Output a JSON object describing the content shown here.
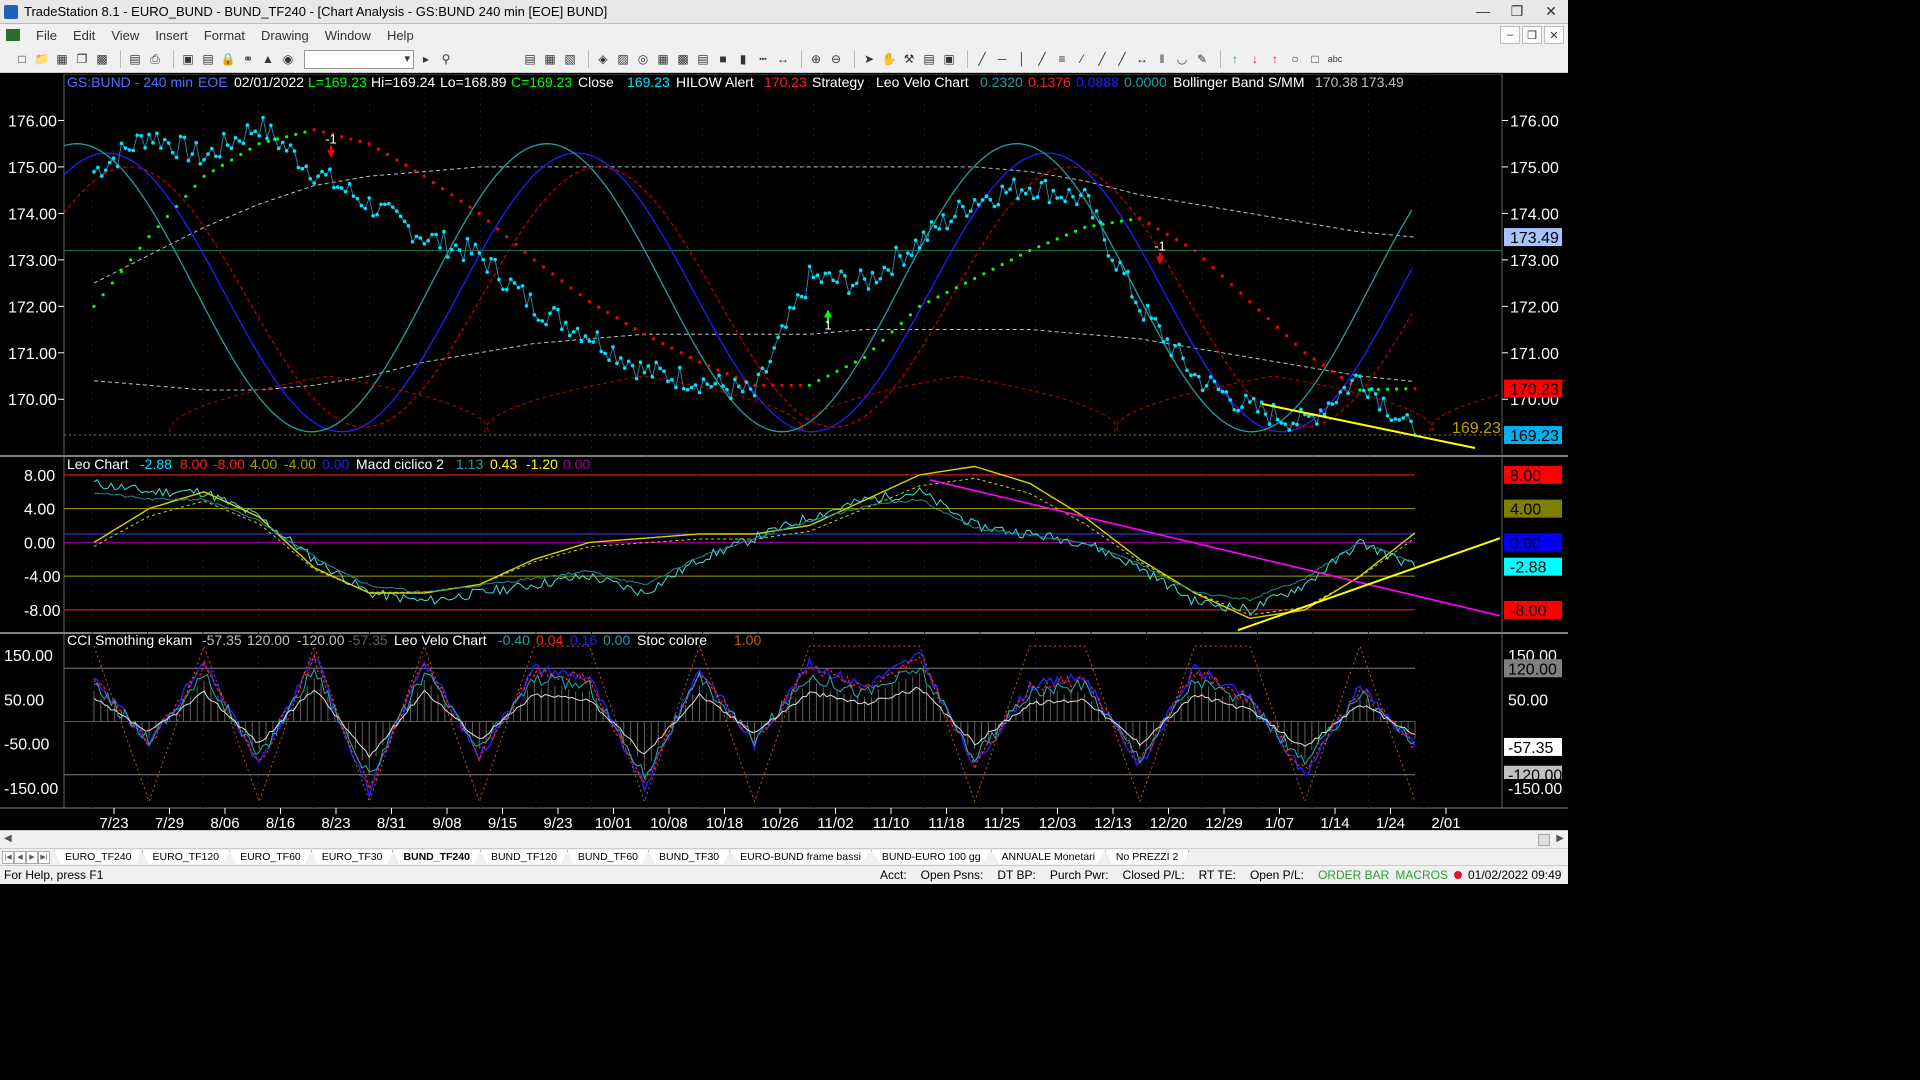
{
  "window": {
    "title": "TradeStation 8.1 - EURO_BUND - BUND_TF240 - [Chart Analysis - GS:BUND  240 min  [EOE] BUND]"
  },
  "menu": [
    "File",
    "Edit",
    "View",
    "Insert",
    "Format",
    "Drawing",
    "Window",
    "Help"
  ],
  "legend": {
    "symbol": "GS:BUND - 240 min",
    "exch": "EOE",
    "date": "02/01/2022",
    "low_label": "L=169.23",
    "high_label": "Hi=169.24",
    "lo_label": "Lo=168.89",
    "close_label": "C=169.23",
    "close_title": "Close",
    "close_value": "169.23",
    "hilow_title": "HILOW Alert",
    "hilow_value": "170.23",
    "strategy": "Strategy",
    "leovelo_title": "Leo Velo Chart",
    "leovelo_vals": [
      "0.2320",
      "0.1376",
      "0.0888",
      "0.0000"
    ],
    "bollinger_title": "Bollinger Band S/MM",
    "bollinger_vals": [
      "170.38",
      "173.49"
    ]
  },
  "leo_legend": {
    "title": "Leo Chart",
    "vals": [
      "-2.88",
      "8.00",
      "-8.00",
      "4.00",
      "-4.00",
      "0.00"
    ],
    "macd_title": "Macd ciclico 2",
    "macd_vals": [
      "1.13",
      "0.43",
      "-1.20",
      "0.00"
    ]
  },
  "cci_legend": {
    "title": "CCI Smothing ekam",
    "vals": [
      "-57.35",
      "120.00",
      "-120.00",
      "-57.35"
    ],
    "leovelo_title": "Leo Velo Chart",
    "leovelo_vals": [
      "-0.40",
      "0.04",
      "0.16",
      "0.00"
    ],
    "stoc_title": "Stoc colore",
    "stoc_val": "1.00"
  },
  "price_axis": {
    "ticks": [
      "176.00",
      "175.00",
      "174.00",
      "173.00",
      "172.00",
      "171.00",
      "170.00"
    ],
    "tick_values": [
      176,
      175,
      174,
      173,
      172,
      171,
      170
    ],
    "range": [
      168.8,
      177.0
    ],
    "badges": [
      {
        "text": "173.49",
        "value": 173.49,
        "bg": "#a8c4ff",
        "fg": "#000000"
      },
      {
        "text": "170.23",
        "value": 170.23,
        "bg": "#ff0000",
        "fg": "#000000"
      },
      {
        "text": "169.23",
        "value": 169.23,
        "bg": "#00b0f0",
        "fg": "#000000"
      }
    ],
    "last_price_label": "169.23"
  },
  "leo_axis": {
    "ticks": [
      "8.00",
      "4.00",
      "0.00",
      "-4.00",
      "-8.00"
    ],
    "tick_values": [
      8,
      4,
      0,
      -4,
      -8
    ],
    "range": [
      -10.5,
      10.0
    ],
    "badges": [
      {
        "text": "8.00",
        "value": 8,
        "bg": "#ff0000",
        "fg": "#000000"
      },
      {
        "text": "4.00",
        "value": 4,
        "bg": "#808000",
        "fg": "#000000"
      },
      {
        "text": "0.00",
        "value": 0,
        "bg": "#0000ff",
        "fg": "#000000"
      },
      {
        "text": "-2.88",
        "value": -2.88,
        "bg": "#00ffff",
        "fg": "#000000"
      },
      {
        "text": "-8.00",
        "value": -8,
        "bg": "#ff0000",
        "fg": "#000000"
      }
    ]
  },
  "cci_axis": {
    "ticks": [
      "150.00",
      "50.00",
      "-50.00",
      "-150.00"
    ],
    "tick_values": [
      150,
      50,
      -50,
      -150
    ],
    "range": [
      -195,
      195
    ],
    "badges": [
      {
        "text": "150.00",
        "value": 150,
        "bg": "#000000",
        "fg": "#ffffff"
      },
      {
        "text": "120.00",
        "value": 120,
        "bg": "#808080",
        "fg": "#000000"
      },
      {
        "text": "50.00",
        "value": 50,
        "bg": "#000000",
        "fg": "#ffffff"
      },
      {
        "text": "-57.35",
        "value": -57.35,
        "bg": "#ffffff",
        "fg": "#000000"
      },
      {
        "text": "-120.00",
        "value": -120,
        "bg": "#c0c0c0",
        "fg": "#000000"
      },
      {
        "text": "-150.00",
        "value": -150,
        "bg": "#000000",
        "fg": "#ffffff"
      }
    ]
  },
  "date_axis": [
    "7/23",
    "7/29",
    "8/06",
    "8/16",
    "8/23",
    "8/31",
    "9/08",
    "9/15",
    "9/23",
    "10/01",
    "10/08",
    "10/18",
    "10/26",
    "11/02",
    "11/10",
    "11/18",
    "11/25",
    "12/03",
    "12/13",
    "12/20",
    "12/29",
    "1/07",
    "1/14",
    "1/24",
    "2/01"
  ],
  "signals": [
    {
      "label": "-1",
      "type": "short"
    },
    {
      "label": "1",
      "type": "long"
    },
    {
      "label": "-1",
      "type": "short"
    }
  ],
  "tabs": [
    "EURO_TF240",
    "EURO_TF120",
    "EURO_TF60",
    "EURO_TF30",
    "BUND_TF240",
    "BUND_TF120",
    "BUND_TF60",
    "BUND_TF30",
    "EURO-BUND frame bassi",
    "BUND-EURO 100 gg",
    "ANNUALE Monetari",
    "No PREZZI 2"
  ],
  "active_tab": "BUND_TF240",
  "status": {
    "help": "For Help, press F1",
    "fields": [
      "Acct:",
      "Open Psns:",
      "DT BP:",
      "Purch Pwr:",
      "Closed P/L:",
      "RT TE:",
      "Open P/L:"
    ],
    "order_bar": "ORDER BAR",
    "macros": "MACROS",
    "datetime": "01/02/2022 09:49"
  },
  "colors": {
    "price_dots": "#00e5ff",
    "trend_up": "#00ff00",
    "trend_down": "#ff0000",
    "bollinger": "#c0c0c0",
    "blue_wave": "#2020ff",
    "teal_wave": "#20a0a0",
    "red_dash": "#c00000",
    "yellow_trend": "#ffff00",
    "magenta_trend": "#ff00ff"
  },
  "chart_data": [
    {
      "type": "line",
      "title": "GS:BUND - 240 min",
      "series": [
        {
          "name": "Close",
          "x": [
            "7/23",
            "7/29",
            "8/06",
            "8/16",
            "8/23",
            "8/31",
            "9/08",
            "9/15",
            "9/23",
            "10/01",
            "10/08",
            "10/18",
            "10/26",
            "11/02",
            "11/10",
            "11/18",
            "11/25",
            "12/03",
            "12/13",
            "12/20",
            "12/29",
            "1/07",
            "1/14",
            "1/24",
            "2/01"
          ],
          "values": [
            174.9,
            175.7,
            175.2,
            175.9,
            174.9,
            174.2,
            173.5,
            173.1,
            172.0,
            171.4,
            170.6,
            170.4,
            170.1,
            172.6,
            172.5,
            173.4,
            174.3,
            174.6,
            174.3,
            172.0,
            170.5,
            169.8,
            169.5,
            170.5,
            169.23
          ]
        }
      ],
      "ylim": [
        168.8,
        177.0
      ]
    },
    {
      "type": "line",
      "title": "Leo Chart",
      "series": [
        {
          "name": "Leo Chart",
          "values": [
            7.0,
            6.0,
            6.0,
            3.0,
            -2.0,
            -6.0,
            -7.0,
            -6.0,
            -5.0,
            -4.0,
            -6.0,
            -2.0,
            0.5,
            3.0,
            5.0,
            6.0,
            2.0,
            1.0,
            0.0,
            -3.0,
            -7.0,
            -8.0,
            -5.0,
            0.0,
            -2.88
          ]
        },
        {
          "name": "Macd ciclico 2",
          "values": [
            0.0,
            4.0,
            6.0,
            3.0,
            -3.0,
            -6.0,
            -6.0,
            -5.0,
            -2.0,
            0.0,
            0.5,
            1.0,
            1.0,
            2.0,
            5.0,
            8.0,
            9.0,
            7.0,
            3.0,
            -2.0,
            -6.0,
            -9.0,
            -8.0,
            -4.0,
            1.13
          ]
        }
      ],
      "ylim": [
        -10.5,
        10.0
      ]
    },
    {
      "type": "line",
      "title": "CCI Smothing ekam",
      "series": [
        {
          "name": "CCI Smothing ekam",
          "values": [
            100,
            -50,
            130,
            -100,
            150,
            -160,
            140,
            -80,
            120,
            100,
            -150,
            120,
            -50,
            130,
            80,
            150,
            -100,
            80,
            100,
            -100,
            120,
            50,
            -120,
            80,
            -57.35
          ]
        }
      ],
      "ylim": [
        -195,
        195
      ]
    }
  ]
}
